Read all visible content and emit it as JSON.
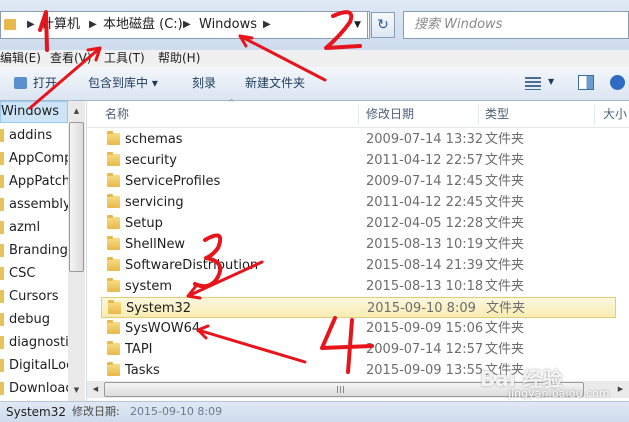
{
  "address": {
    "breadcrumbs": [
      "计算机",
      "本地磁盘 (C:)",
      "Windows"
    ],
    "search_placeholder": "搜索 Windows"
  },
  "menu": [
    "编辑(E)",
    "查看(V)",
    "工具(T)",
    "帮助(H)"
  ],
  "toolbar": {
    "open": "打开",
    "include": "包含到库中 ▾",
    "burn": "刻录",
    "new_folder": "新建文件夹"
  },
  "nav": {
    "header": "Windows",
    "items": [
      "addins",
      "AppComp",
      "AppPatch",
      "assembly",
      "azml",
      "Branding",
      "CSC",
      "Cursors",
      "debug",
      "diagnostic",
      "DigitalLock",
      "Download"
    ]
  },
  "columns": {
    "name": "名称",
    "date": "修改日期",
    "type": "类型",
    "size": "大小"
  },
  "files": [
    {
      "name": "schemas",
      "date": "2009-07-14 13:32",
      "type": "文件夹"
    },
    {
      "name": "security",
      "date": "2011-04-12 22:57",
      "type": "文件夹"
    },
    {
      "name": "ServiceProfiles",
      "date": "2009-07-14 12:45",
      "type": "文件夹"
    },
    {
      "name": "servicing",
      "date": "2011-04-12 22:45",
      "type": "文件夹"
    },
    {
      "name": "Setup",
      "date": "2012-04-05 12:28",
      "type": "文件夹"
    },
    {
      "name": "ShellNew",
      "date": "2015-08-13 10:19",
      "type": "文件夹"
    },
    {
      "name": "SoftwareDistribution",
      "date": "2015-08-14 21:39",
      "type": "文件夹"
    },
    {
      "name": "system",
      "date": "2015-08-13 10:18",
      "type": "文件夹"
    },
    {
      "name": "System32",
      "date": "2015-09-10 8:09",
      "type": "文件夹",
      "selected": true
    },
    {
      "name": "SysWOW64",
      "date": "2015-09-09 15:06",
      "type": "文件夹"
    },
    {
      "name": "TAPI",
      "date": "2009-07-14 12:57",
      "type": "文件夹"
    },
    {
      "name": "Tasks",
      "date": "2015-09-09 13:55",
      "type": "文件夹"
    }
  ],
  "status": {
    "name": "System32",
    "meta_label": "修改日期:",
    "meta_value": "2015-09-10 8:09"
  },
  "annotations": {
    "marks": [
      "1",
      "2",
      "3",
      "4"
    ],
    "color": "#e8141b"
  },
  "watermark": {
    "text": "Bai 经验",
    "url": "jingyan.baidu.com"
  }
}
